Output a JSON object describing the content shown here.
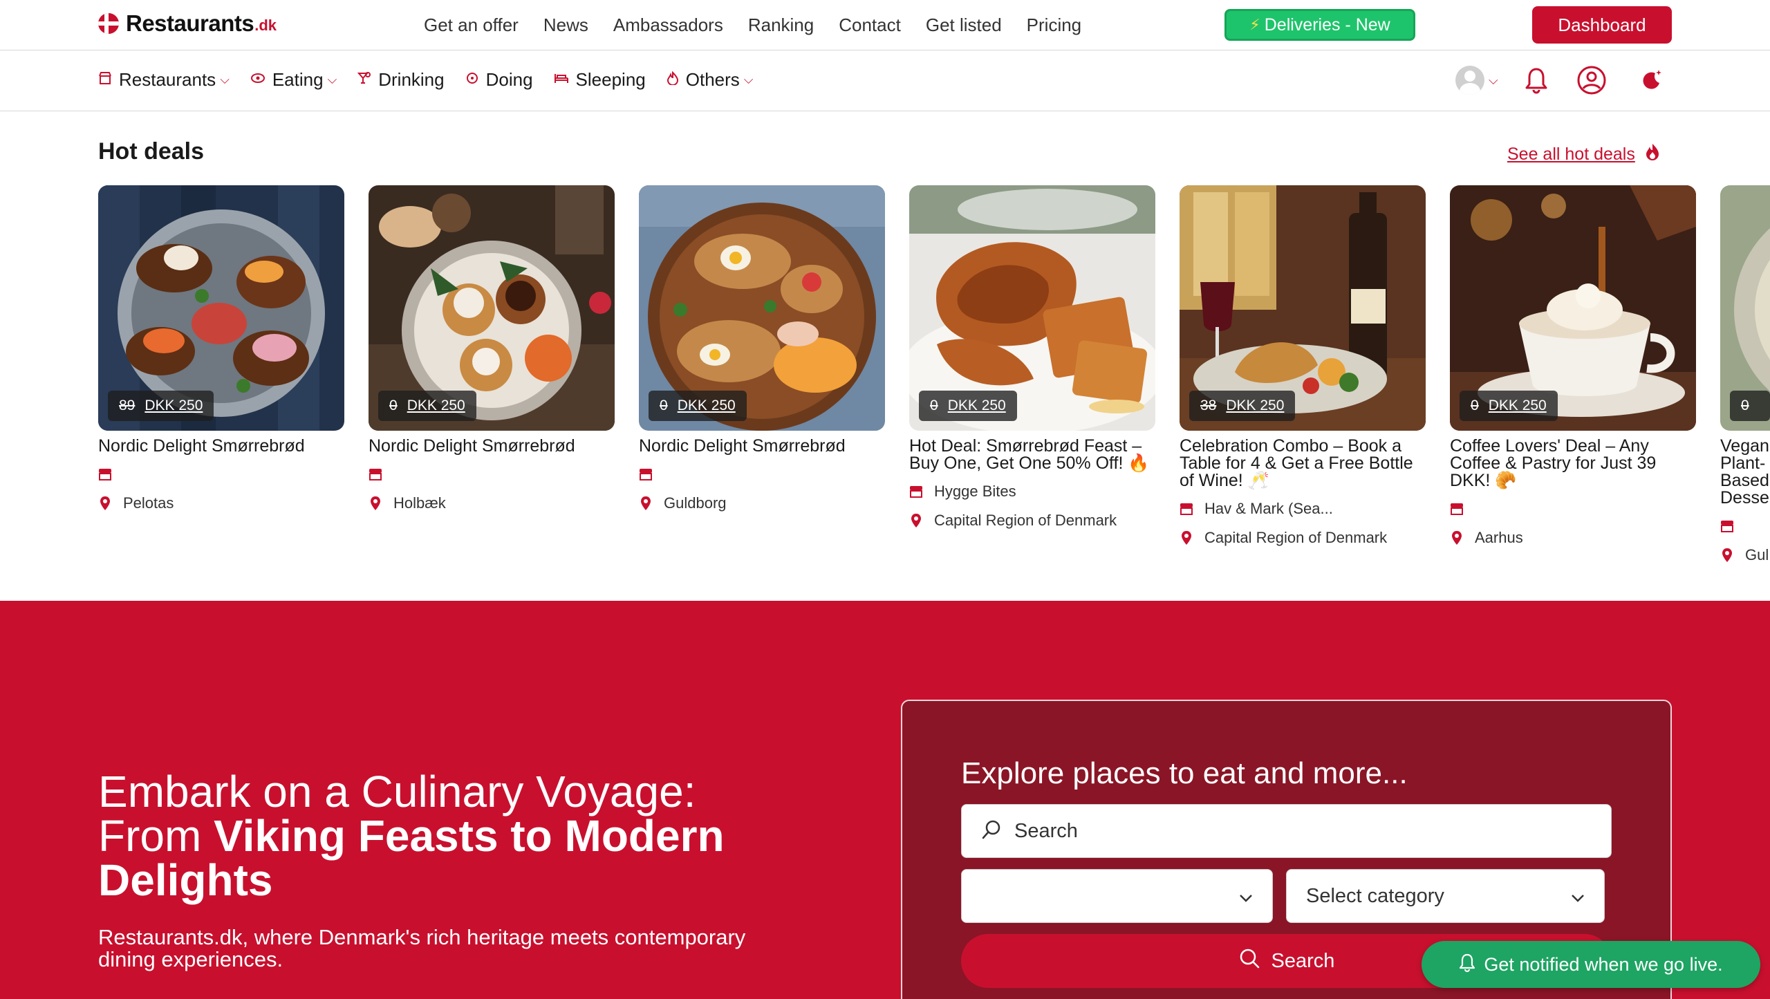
{
  "brand": {
    "name": "Restaurants",
    "tld": ".dk"
  },
  "topnav": [
    "Get an offer",
    "News",
    "Ambassadors",
    "Ranking",
    "Contact",
    "Get listed",
    "Pricing"
  ],
  "deliveries_label": "Deliveries - New",
  "dashboard_label": "Dashboard",
  "categories": [
    {
      "label": "Restaurants",
      "icon": "store-icon",
      "dropdown": true
    },
    {
      "label": "Eating",
      "icon": "eye-icon",
      "dropdown": true
    },
    {
      "label": "Drinking",
      "icon": "cocktail-icon",
      "dropdown": false
    },
    {
      "label": "Doing",
      "icon": "activity-icon",
      "dropdown": false
    },
    {
      "label": "Sleeping",
      "icon": "bed-icon",
      "dropdown": false
    },
    {
      "label": "Others",
      "icon": "flame-icon",
      "dropdown": true
    }
  ],
  "hot_deals": {
    "title": "Hot deals",
    "see_all": "See all hot deals",
    "cards": [
      {
        "title": "Nordic Delight Smørrebrød",
        "old_price": "89",
        "new_price": "DKK 250",
        "venue": "",
        "location": "Pelotas"
      },
      {
        "title": "Nordic Delight Smørrebrød",
        "old_price": "0",
        "new_price": "DKK 250",
        "venue": "",
        "location": "Holbæk"
      },
      {
        "title": "Nordic Delight Smørrebrød",
        "old_price": "0",
        "new_price": "DKK 250",
        "venue": "",
        "location": "Guldborg"
      },
      {
        "title": "Hot Deal: Smørrebrød Feast – Buy One, Get One 50% Off! 🔥",
        "old_price": "0",
        "new_price": "DKK 250",
        "venue": "Hygge Bites",
        "location": "Capital Region of Denmark"
      },
      {
        "title": "Celebration Combo – Book a Table for 4 & Get a Free Bottle of Wine! 🥂",
        "old_price": "38",
        "new_price": "DKK 250",
        "venue": "Hav & Mark (Sea...",
        "location": "Capital Region of Denmark"
      },
      {
        "title": "Coffee Lovers' Deal – Any Coffee & Pastry for Just 39 DKK! 🥐",
        "old_price": "0",
        "new_price": "DKK 250",
        "venue": "",
        "location": "Aarhus"
      },
      {
        "title": "Vegan Plant-Based Dessert",
        "old_price": "0",
        "new_price": "",
        "venue": "",
        "location": "Gul"
      }
    ]
  },
  "hero": {
    "headline_plain": "Embark on a Culinary Voyage: From ",
    "headline_bold": "Viking Feasts to Modern Delights",
    "subtitle": "Restaurants.dk, where Denmark's rich heritage meets contemporary dining experiences."
  },
  "explore": {
    "title": "Explore places to eat and more...",
    "search_placeholder": "Search",
    "select_location_value": "",
    "select_category_value": "Select category",
    "search_button": "Search"
  },
  "notify_label": "Get notified when we go live.",
  "colors": {
    "brand_red": "#c8102e",
    "panel_red": "#8a1526",
    "green": "#1ec46b"
  }
}
